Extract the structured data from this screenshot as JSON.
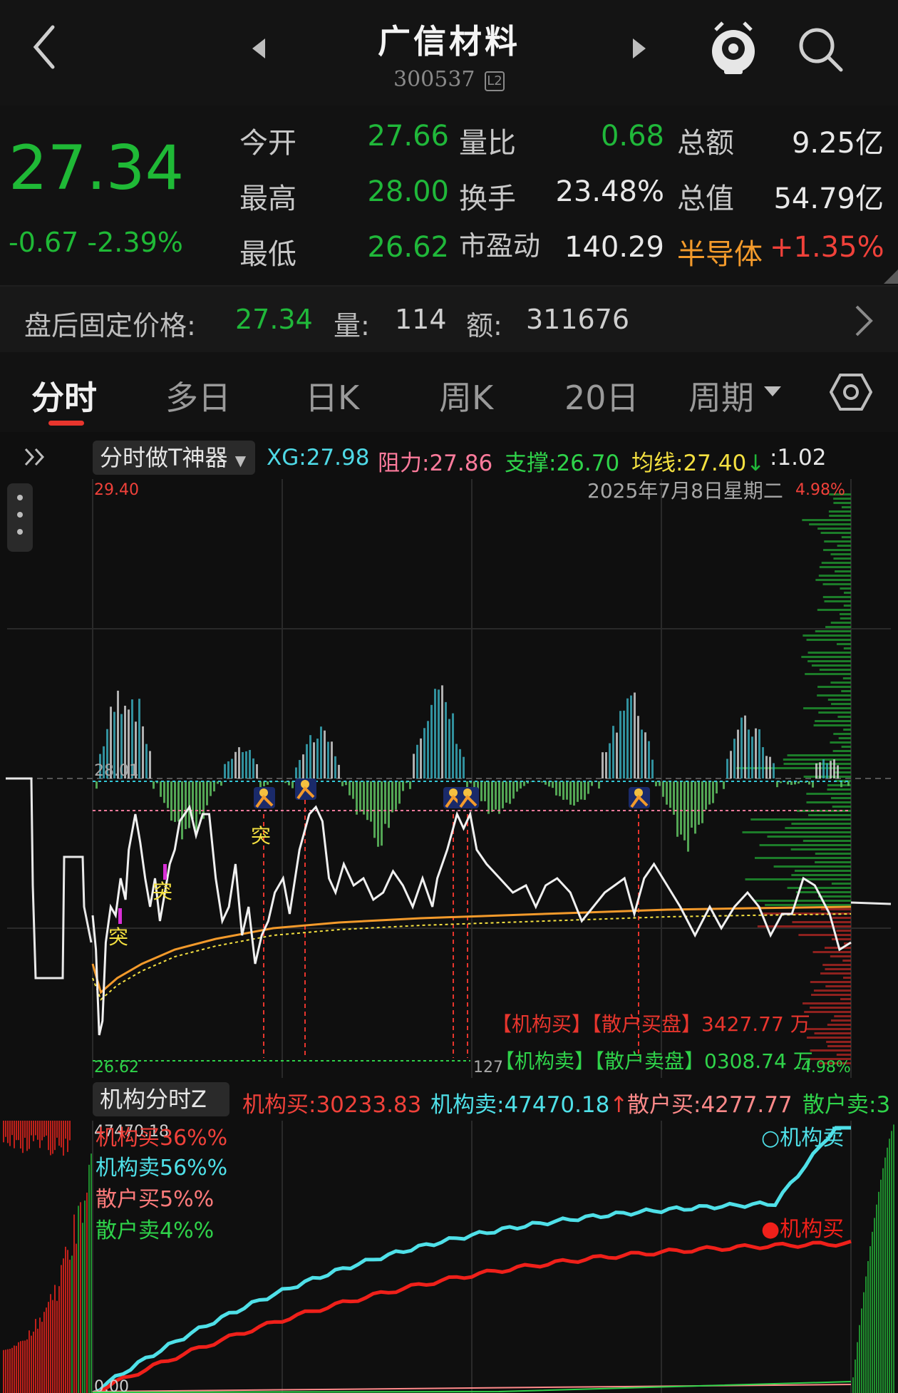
{
  "header": {
    "title": "广信材料",
    "code": "300537",
    "code_badge": "L2"
  },
  "quote": {
    "price": "27.34",
    "change": "-0.67",
    "change_pct": "-2.39%",
    "rows": [
      {
        "label1": "今开",
        "val1": "27.66",
        "label2": "量比",
        "val2": "0.68",
        "label3": "总额",
        "val3": "9.25亿"
      },
      {
        "label1": "最高",
        "val1": "28.00",
        "label2": "换手",
        "val2": "23.48%",
        "label3": "总值",
        "val3": "54.79亿"
      },
      {
        "label1": "最低",
        "val1": "26.62",
        "label2": "市盈动",
        "val2": "140.29",
        "label3": "半导体",
        "val3": "+1.35%"
      }
    ]
  },
  "after_hours": {
    "label": "盘后固定价格:",
    "price": "27.34",
    "vol_label": "量:",
    "vol": "114",
    "amt_label": "额:",
    "amt": "311676"
  },
  "tabs": [
    "分时",
    "多日",
    "日K",
    "周K",
    "20日",
    "周期"
  ],
  "indicator1": {
    "name": "分时做T神器",
    "xg_label": "XG:",
    "xg": "27.98",
    "resist_label": "阻力:",
    "resist": "27.86",
    "support_label": "支撑:",
    "support": "26.70",
    "ma_label": "均线:",
    "ma": "27.40",
    "ratio": ":1.02"
  },
  "main_chart": {
    "date_text": "2025年7月8日星期二",
    "top_price": "29.40",
    "top_pct": "4.98%",
    "mid_price": "28.01",
    "bottom_price": "26.62",
    "bottom_pct": "-4.98%",
    "bottom_vol": "127",
    "tag_buy": "突",
    "overlay1": "【机构买】【散户买盘】3427.77 万",
    "overlay2": "【机构卖】【散户卖盘】0308.74 万"
  },
  "indicator2": {
    "name": "机构分时Z",
    "inst_buy_label": "机构买:",
    "inst_buy": "30233.83",
    "inst_sell_label": "机构卖:",
    "inst_sell": "47470.18",
    "retail_buy_label": "散户买:",
    "retail_buy": "4277.77",
    "retail_sell_label": "散户卖:",
    "retail_sell": "3"
  },
  "sub_chart": {
    "top_value": "47470.18",
    "bottom_value": "0.00",
    "legend": [
      "机构买36%%",
      "机构卖56%%",
      "散户买5%%",
      "散户卖4%%"
    ],
    "line_label_sell": "○机构卖",
    "line_label_buy": "●机构买"
  },
  "colors": {
    "down_green": "#1fb936",
    "up_red": "#f0413a",
    "cyan": "#4fe0e8",
    "orange": "#f39a2b",
    "yellow": "#f4e040"
  }
}
